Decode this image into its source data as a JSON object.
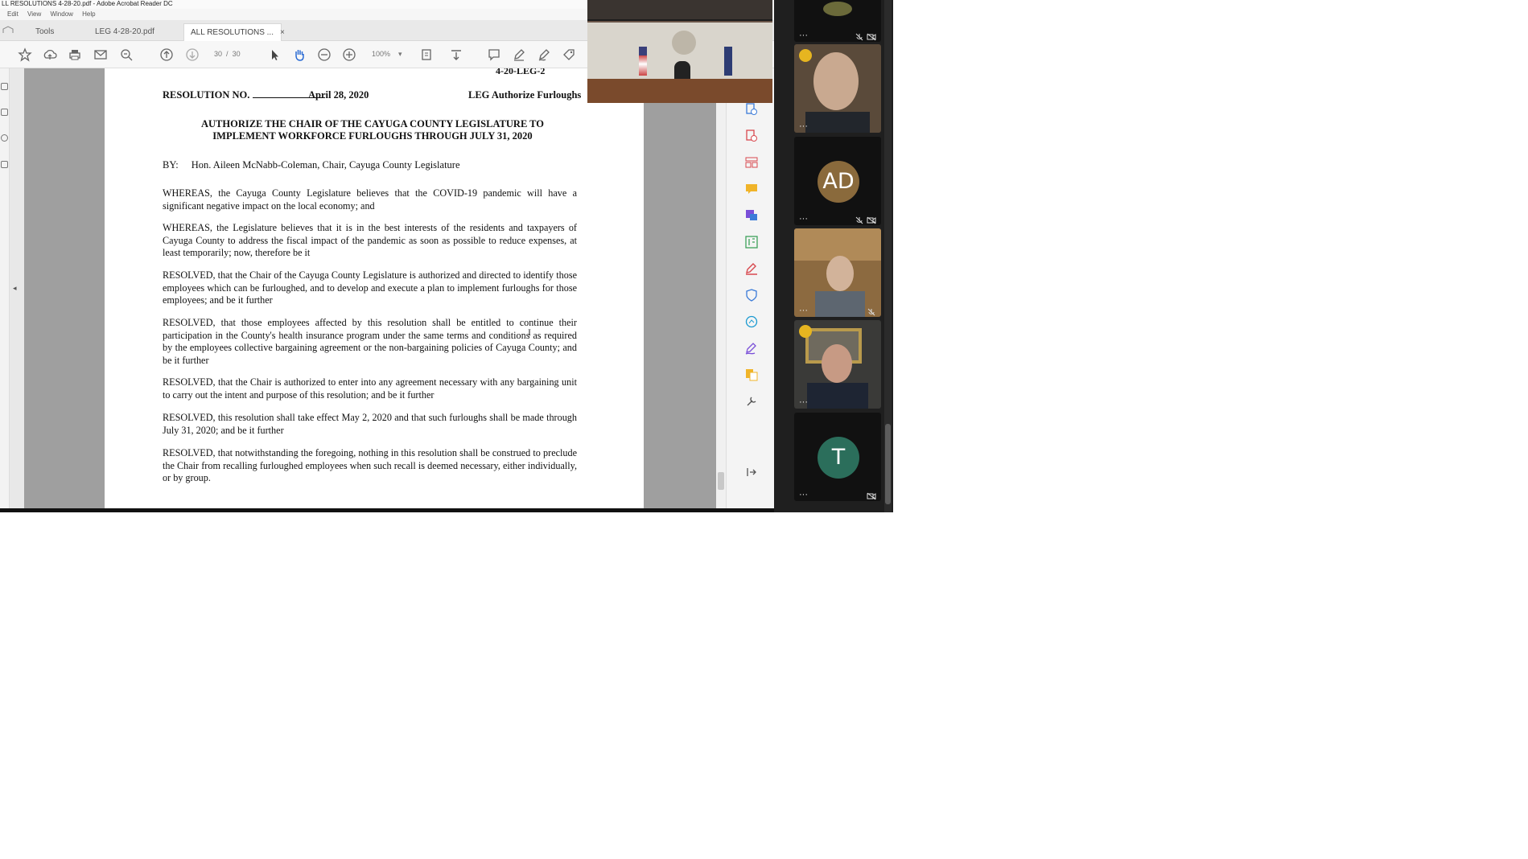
{
  "acrobat": {
    "window_title": "LL RESOLUTIONS 4-28-20.pdf - Adobe Acrobat Reader DC",
    "menu": [
      "Edit",
      "View",
      "Window",
      "Help"
    ],
    "tabs": [
      {
        "label": "Tools"
      },
      {
        "label": "LEG 4-28-20.pdf"
      },
      {
        "label": "ALL RESOLUTIONS ..."
      }
    ],
    "tab_close": "×",
    "toolbar": {
      "page_current": "30",
      "page_sep": "/",
      "page_total": "30",
      "zoom": "100%",
      "tools": [
        "star-icon",
        "cloud-upload-icon",
        "print-icon",
        "mail-icon",
        "zoom-out-search-icon",
        "page-up-icon",
        "page-down-icon",
        "select-arrow-icon",
        "hand-icon",
        "zoom-out-icon",
        "zoom-in-icon",
        "fit-page-icon",
        "scroll-mode-icon",
        "comment-icon",
        "highlight-pen-icon",
        "sign-icon",
        "tag-icon"
      ]
    },
    "document": {
      "top_ref": "4-20-LEG-2",
      "resolution_label": "RESOLUTION NO.",
      "date": "April 28, 2020",
      "short_title": "LEG Authorize Furloughs",
      "title_line1": "AUTHORIZE THE CHAIR OF THE CAYUGA COUNTY LEGISLATURE TO",
      "title_line2": "IMPLEMENT WORKFORCE FURLOUGHS THROUGH JULY 31, 2020",
      "by_label": "BY:",
      "by_name": "Hon. Aileen McNabb-Coleman, Chair, Cayuga County Legislature",
      "paragraphs": [
        "WHEREAS, the Cayuga County Legislature believes that the COVID-19 pandemic will have a significant negative impact on the local economy; and",
        "WHEREAS, the Legislature believes that it is in the best interests of the residents and taxpayers of Cayuga County to address the fiscal impact of the pandemic as soon as possible to reduce expenses, at least temporarily; now, therefore be it",
        "RESOLVED, that the Chair of the Cayuga County Legislature is authorized and directed to identify those employees which can be furloughed, and to develop and execute a plan to implement furloughs for those employees; and be it further",
        "RESOLVED, that those employees affected by this resolution shall be entitled to continue their participation in the County's health insurance program under the same terms and conditions as required by the employees collective bargaining agreement or the non-bargaining policies of Cayuga County; and be it further",
        "RESOLVED, that the Chair is authorized to enter into any agreement necessary with any bargaining unit to carry out the intent and purpose of this resolution; and be it further",
        "RESOLVED, this resolution shall take effect May 2, 2020 and that such furloughs shall be made through July 31, 2020; and be it further",
        "RESOLVED, that notwithstanding the foregoing, nothing in this resolution shall be construed to preclude the Chair from recalling furloughed employees when such recall is deemed necessary, either individually, or by group."
      ]
    },
    "tools_pane_icons": [
      "create-pdf-icon",
      "export-pdf-icon",
      "organize-pages-icon",
      "comment-icon",
      "send-sign-icon",
      "edit-pdf-icon",
      "fill-sign-icon",
      "protect-icon",
      "measure-icon",
      "sign-pen-icon",
      "combine-files-icon",
      "more-tools-icon",
      "collapse-pane-icon"
    ]
  },
  "zoom": {
    "tiles": [
      {
        "kind": "video",
        "speaking": false,
        "muted": true,
        "cam_off": true
      },
      {
        "kind": "video",
        "speaking": true,
        "muted": false,
        "cam_off": false
      },
      {
        "kind": "avatar",
        "initials": "AD",
        "avatar_color": "#8a6a3c",
        "muted": true,
        "cam_off": true
      },
      {
        "kind": "video",
        "speaking": false,
        "muted": true,
        "cam_off": false
      },
      {
        "kind": "video",
        "speaking": true,
        "muted": false,
        "cam_off": false
      },
      {
        "kind": "avatar",
        "initials": "T",
        "avatar_color": "#2b6e5b",
        "muted": false,
        "cam_off": true
      }
    ],
    "more_label": "···"
  },
  "colors": {
    "acrobat_bg": "#f3f3f3",
    "document_gray": "#9f9f9f",
    "zoom_bg": "#1f1f1f",
    "speaking_badge": "#e6b520"
  }
}
